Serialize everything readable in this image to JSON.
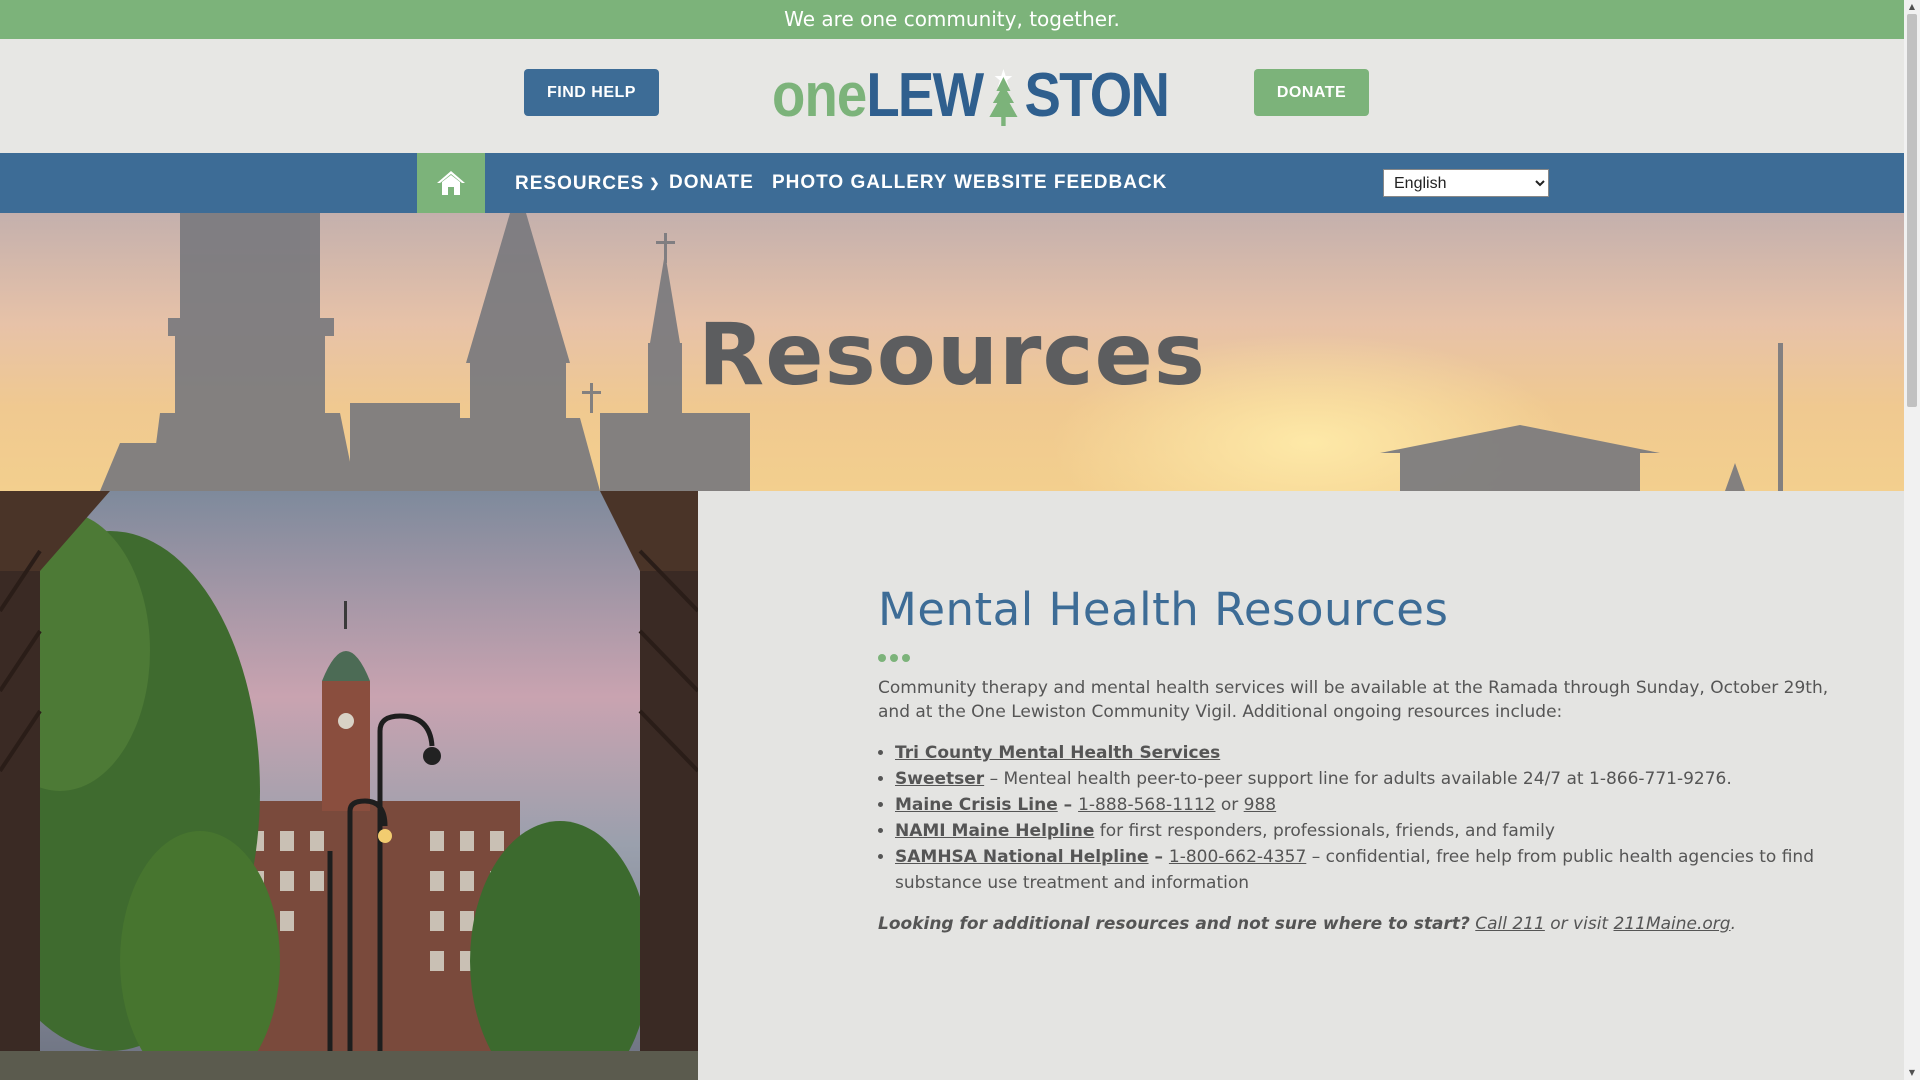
{
  "banner": {
    "text": "We are one community, together."
  },
  "header": {
    "find_help_label": "FIND HELP",
    "donate_label": "DONATE",
    "logo": {
      "part1": "one",
      "part2": "LEW",
      "part3": "STON"
    }
  },
  "nav": {
    "items": [
      {
        "label": "RESOURCES"
      },
      {
        "label": "DONATE"
      },
      {
        "label": "PHOTO GALLERY"
      },
      {
        "label": "WEBSITE FEEDBACK"
      }
    ],
    "language": {
      "selected": "English"
    }
  },
  "hero": {
    "title": "Resources"
  },
  "main": {
    "heading": "Mental Health Resources",
    "intro": "Community therapy and mental health services will be available at the Ramada through Sunday, October 29th, and at the One Lewiston Community Vigil. Additional ongoing resources include:",
    "resources": [
      {
        "name": "Tri County Mental Health Services"
      },
      {
        "name": "Sweetser",
        "desc": " – Menteal health peer-to-peer support line for adults available 24/7 at 1-866-771-9276."
      },
      {
        "name": "Maine Crisis Line",
        "sep": " – ",
        "phone": "1-888-568-1112",
        "or": " or ",
        "alt": "988"
      },
      {
        "name": "NAMI Maine Helpline",
        "desc": " for first responders, professionals, friends, and family"
      },
      {
        "name": "SAMHSA National Helpline",
        "sep": " – ",
        "phone": "1-800-662-4357",
        "desc": " – confidential, free help from public health agencies to find substance use treatment and information"
      }
    ],
    "closing": {
      "question": "Looking for additional resources and not sure where to start?",
      "call_link": "Call 211",
      "or_visit": " or visit ",
      "site_link": "211Maine.org",
      "end": "."
    }
  },
  "colors": {
    "green": "#7cb37a",
    "blue": "#3d6c96",
    "header_bg": "#e7e7e4",
    "page_bg": "#e4e4e2"
  },
  "icons": {
    "home": "home-icon",
    "dropdown": "chevron-down-icon"
  }
}
